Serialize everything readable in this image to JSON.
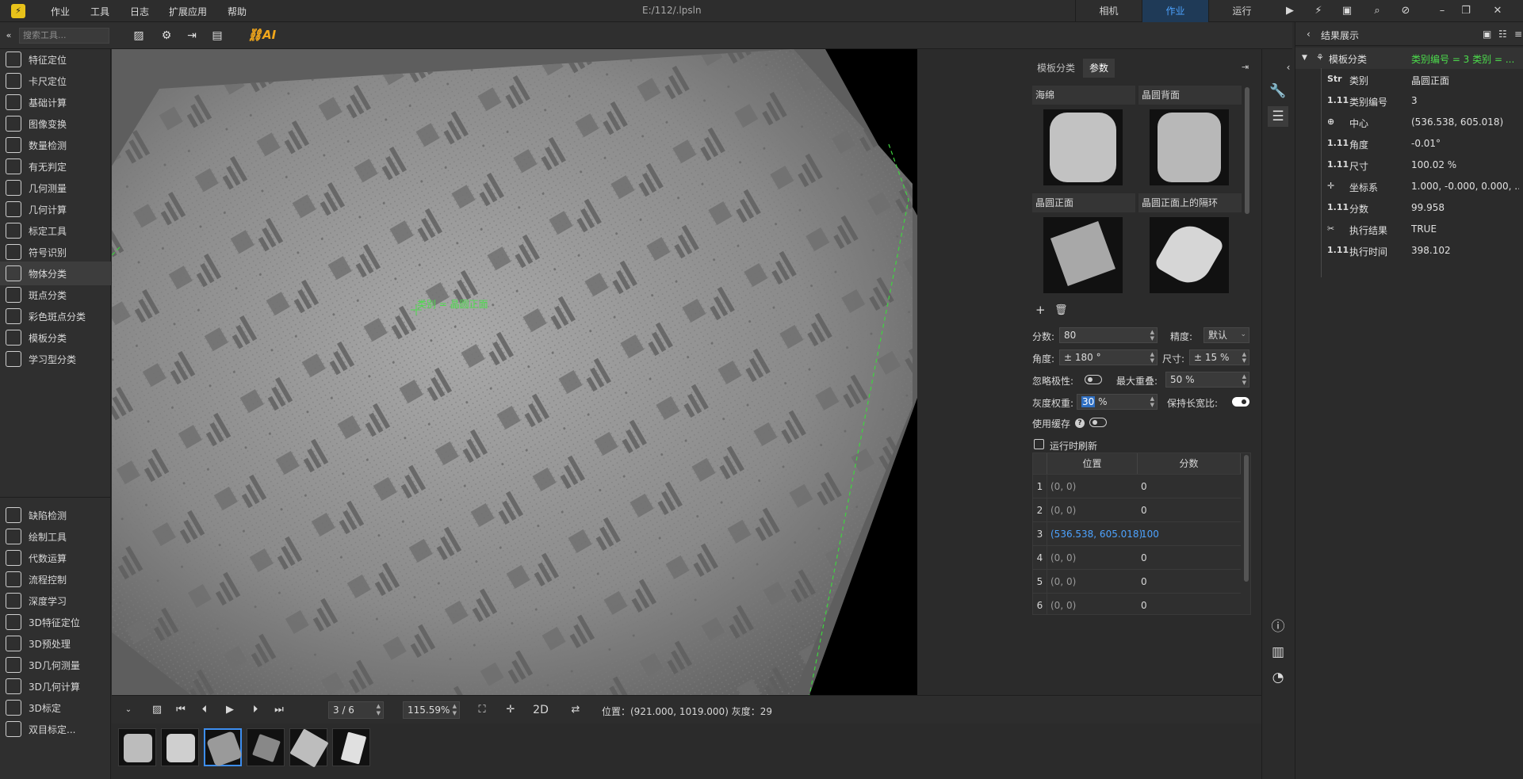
{
  "titlebar": {
    "menus": [
      "作业",
      "工具",
      "日志",
      "扩展应用",
      "帮助"
    ],
    "file_path": "E:/112/.lpsln",
    "modes": [
      "相机",
      "作业",
      "运行"
    ],
    "active_mode": "作业"
  },
  "toolbar": {
    "search_placeholder": "搜索工具...",
    "ai_label": "AI"
  },
  "sidebar": {
    "items": [
      {
        "label": "特征定位",
        "icon": "pin-icon"
      },
      {
        "label": "卡尺定位",
        "icon": "caliper-icon"
      },
      {
        "label": "基础计算",
        "icon": "infinity-icon"
      },
      {
        "label": "图像变换",
        "icon": "rings-icon"
      },
      {
        "label": "数量检测",
        "icon": "count-icon"
      },
      {
        "label": "有无判定",
        "icon": "question-icon"
      },
      {
        "label": "几何测量",
        "icon": "ruler-icon"
      },
      {
        "label": "几何计算",
        "icon": "geometry-icon"
      },
      {
        "label": "标定工具",
        "icon": "calibrate-icon"
      },
      {
        "label": "符号识别",
        "icon": "ocr-icon"
      },
      {
        "label": "物体分类",
        "icon": "brain-icon"
      },
      {
        "label": "斑点分类",
        "icon": "blob-icon"
      },
      {
        "label": "彩色斑点分类",
        "icon": "color-blob-icon"
      },
      {
        "label": "模板分类",
        "icon": "template-icon"
      },
      {
        "label": "学习型分类",
        "icon": "learn-icon"
      }
    ],
    "items2": [
      {
        "label": "缺陷检测",
        "icon": "defect-icon"
      },
      {
        "label": "绘制工具",
        "icon": "draw-icon"
      },
      {
        "label": "代数运算",
        "icon": "algebra-icon"
      },
      {
        "label": "流程控制",
        "icon": "flow-icon"
      },
      {
        "label": "深度学习",
        "icon": "ai-icon"
      },
      {
        "label": "3D特征定位",
        "icon": "pin-3d-icon"
      },
      {
        "label": "3D预处理",
        "icon": "preprocess-3d-icon"
      },
      {
        "label": "3D几何测量",
        "icon": "cube-icon"
      },
      {
        "label": "3D几何计算",
        "icon": "cube-calc-icon"
      },
      {
        "label": "3D标定",
        "icon": "calib-3d-icon"
      },
      {
        "label": "双目标定...",
        "icon": "stereo-icon"
      }
    ],
    "active": "物体分类"
  },
  "canvas": {
    "match_label": "类别 = 晶圆正面"
  },
  "controls": {
    "frame": "3 / 6",
    "zoom": "115.59%",
    "mode_2d": "2D",
    "status": "位置：(921.000, 1019.000)  灰度：29"
  },
  "params": {
    "tabs": [
      "模板分类",
      "参数"
    ],
    "active_tab": "参数",
    "templates": [
      "海绵",
      "晶圆背面",
      "晶圆正面",
      "晶圆正面上的隔环"
    ],
    "score_label": "分数:",
    "score_value": "80",
    "precision_label": "精度:",
    "precision_value": "默认",
    "angle_label": "角度:",
    "angle_value": "± 180 °",
    "size_label": "尺寸:",
    "size_value": "± 15 %",
    "ignore_polarity_label": "忽略极性:",
    "max_overlap_label": "最大重叠:",
    "max_overlap_value": "50 %",
    "gray_weight_label": "灰度权重:",
    "gray_weight_value": "30",
    "gray_weight_unit": "%",
    "keep_ratio_label": "保持长宽比:",
    "use_cache_label": "使用缓存",
    "refresh_label": "运行时刷新",
    "table_headers": [
      "位置",
      "分数"
    ],
    "rows": [
      {
        "idx": "1",
        "pos": "(0, 0)",
        "score": "0"
      },
      {
        "idx": "2",
        "pos": "(0, 0)",
        "score": "0"
      },
      {
        "idx": "3",
        "pos": "(536.538, 605.018)",
        "score": "100"
      },
      {
        "idx": "4",
        "pos": "(0, 0)",
        "score": "0"
      },
      {
        "idx": "5",
        "pos": "(0, 0)",
        "score": "0"
      },
      {
        "idx": "6",
        "pos": "(0, 0)",
        "score": "0"
      }
    ]
  },
  "results": {
    "title": "结果展示",
    "root_name": "模板分类",
    "root_value": "类别编号 = 3  类别 = ...",
    "items": [
      {
        "type": "Str",
        "name": "类别",
        "value": "晶圆正面"
      },
      {
        "type": "1.11",
        "name": "类别编号",
        "value": "3"
      },
      {
        "type": "⊕",
        "name": "中心",
        "value": "(536.538, 605.018)"
      },
      {
        "type": "1.11",
        "name": "角度",
        "value": "-0.01°"
      },
      {
        "type": "1.11",
        "name": "尺寸",
        "value": "100.02 %"
      },
      {
        "type": "✛",
        "name": "坐标系",
        "value": "1.000, -0.000, 0.000, ..."
      },
      {
        "type": "1.11",
        "name": "分数",
        "value": "99.958"
      },
      {
        "type": "✂",
        "name": "执行结果",
        "value": "TRUE"
      },
      {
        "type": "1.11",
        "name": "执行时间",
        "value": "398.102"
      }
    ]
  },
  "colors": {
    "accent": "#4da3ff",
    "match_green": "#4cdc4c",
    "ai_orange": "#f2a71b"
  }
}
